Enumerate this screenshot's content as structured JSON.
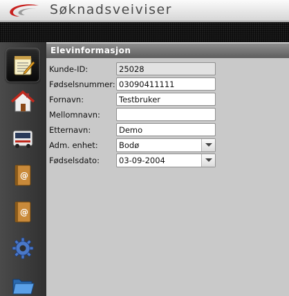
{
  "app": {
    "title": "Søknadsveiviser"
  },
  "sidebar": {
    "items": [
      {
        "name": "notepad",
        "active": true
      },
      {
        "name": "home"
      },
      {
        "name": "bus"
      },
      {
        "name": "address-book"
      },
      {
        "name": "address-book-2"
      },
      {
        "name": "settings"
      },
      {
        "name": "folder"
      }
    ]
  },
  "section": {
    "title": "Elevinformasjon"
  },
  "form": {
    "kunde_id": {
      "label": "Kunde-ID:",
      "value": "25028"
    },
    "fodselsnummer": {
      "label": "Fødselsnummer:",
      "value": "03090411111"
    },
    "fornavn": {
      "label": "Fornavn:",
      "value": "Testbruker"
    },
    "mellomnavn": {
      "label": "Mellomnavn:",
      "value": ""
    },
    "etternavn": {
      "label": "Etternavn:",
      "value": "Demo"
    },
    "adm_enhet": {
      "label": "Adm. enhet:",
      "value": "Bodø"
    },
    "fodselsdato": {
      "label": "Fødselsdato:",
      "value": "03-09-2004"
    }
  },
  "colors": {
    "logo_red": "#c8201e",
    "header_bg": "#6e6e6e",
    "sidebar_bg": "#3c3c3c"
  }
}
